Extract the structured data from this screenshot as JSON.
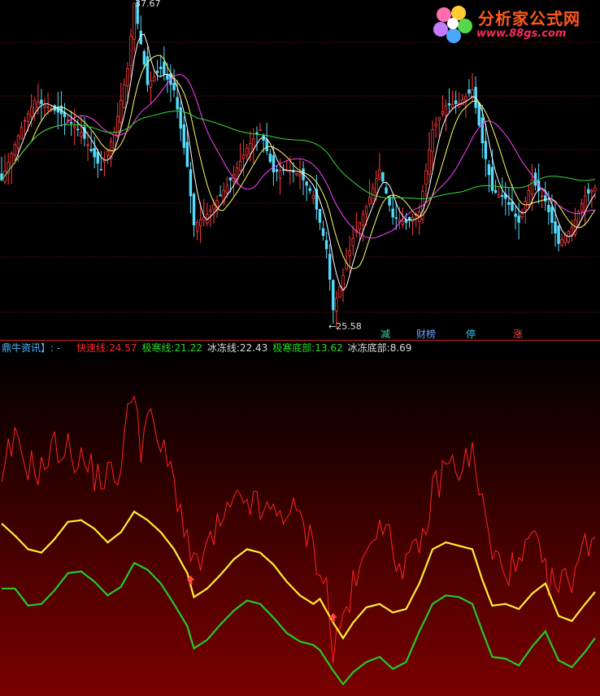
{
  "watermark": {
    "text": "分析家公式网",
    "url": "www.88gs.com"
  },
  "price_panel": {
    "high_label": "37.67",
    "low_label": "←25.58",
    "signals": [
      {
        "text": "减",
        "color": "#33dd99"
      },
      {
        "text": "财榜",
        "color": "#6aa0ff"
      },
      {
        "text": "停",
        "color": "#33ccee"
      },
      {
        "text": "涨",
        "color": "#ff4444"
      }
    ]
  },
  "indicator_panel": {
    "name": "鼎牛资讯】:",
    "items": [
      {
        "label": "快速线:",
        "value": "24.57",
        "color": "#ff2222"
      },
      {
        "label": "极寒线:",
        "value": "21.22",
        "color": "#22dd22"
      },
      {
        "label": "冰冻线:",
        "value": "22.43",
        "color": "#dddddd"
      },
      {
        "label": "极寒底部:",
        "value": "13.62",
        "color": "#22dd22"
      },
      {
        "label": "冰冻底部:",
        "value": "8.69",
        "color": "#dddddd"
      }
    ]
  },
  "chart_data": {
    "type": "line",
    "n": 180,
    "price": {
      "high": 37.67,
      "low": 25.58,
      "anchors": [
        [
          0,
          31
        ],
        [
          6,
          33
        ],
        [
          10,
          34
        ],
        [
          18,
          33.5
        ],
        [
          24,
          32.8
        ],
        [
          30,
          31.4
        ],
        [
          34,
          32.8
        ],
        [
          38,
          35.2
        ],
        [
          40,
          37.67
        ],
        [
          44,
          34.6
        ],
        [
          48,
          35.2
        ],
        [
          52,
          34.4
        ],
        [
          56,
          31.5
        ],
        [
          58,
          29.3
        ],
        [
          62,
          29.7
        ],
        [
          66,
          30.4
        ],
        [
          70,
          31.2
        ],
        [
          74,
          32.2
        ],
        [
          78,
          32.9
        ],
        [
          82,
          31.3
        ],
        [
          86,
          31.4
        ],
        [
          90,
          31.2
        ],
        [
          94,
          30.4
        ],
        [
          98,
          28.4
        ],
        [
          100,
          26.1
        ],
        [
          103,
          27.4
        ],
        [
          106,
          28.8
        ],
        [
          110,
          30.0
        ],
        [
          114,
          31.4
        ],
        [
          118,
          29.6
        ],
        [
          122,
          29.4
        ],
        [
          126,
          29.8
        ],
        [
          130,
          32.9
        ],
        [
          134,
          33.8
        ],
        [
          138,
          33.9
        ],
        [
          142,
          34.4
        ],
        [
          145,
          32.4
        ],
        [
          148,
          30.6
        ],
        [
          152,
          30.3
        ],
        [
          156,
          29.4
        ],
        [
          160,
          31.0
        ],
        [
          164,
          30.2
        ],
        [
          168,
          28.6
        ],
        [
          172,
          29.2
        ],
        [
          176,
          30.4
        ],
        [
          179,
          30.7
        ]
      ]
    },
    "indicator": {
      "fast": [
        [
          0,
          22
        ],
        [
          2,
          24.3
        ],
        [
          4,
          25
        ],
        [
          8,
          23.8
        ],
        [
          12,
          23.4
        ],
        [
          16,
          24.8
        ],
        [
          20,
          24.6
        ],
        [
          24,
          24
        ],
        [
          28,
          23.2
        ],
        [
          32,
          23.0
        ],
        [
          36,
          23.5
        ],
        [
          38,
          26.5
        ],
        [
          40,
          28.7
        ],
        [
          42,
          24.8
        ],
        [
          44,
          26.5
        ],
        [
          48,
          24.8
        ],
        [
          52,
          22.8
        ],
        [
          56,
          19.5
        ],
        [
          58,
          17.5
        ],
        [
          62,
          18.8
        ],
        [
          66,
          20.2
        ],
        [
          70,
          21.2
        ],
        [
          74,
          21.8
        ],
        [
          78,
          21.0
        ],
        [
          82,
          20.8
        ],
        [
          86,
          21.2
        ],
        [
          90,
          20.5
        ],
        [
          94,
          19.0
        ],
        [
          98,
          16.5
        ],
        [
          100,
          12.8
        ],
        [
          103,
          14.8
        ],
        [
          106,
          16.5
        ],
        [
          110,
          18.2
        ],
        [
          114,
          21.2
        ],
        [
          118,
          18.5
        ],
        [
          122,
          18.0
        ],
        [
          126,
          18.5
        ],
        [
          130,
          22.0
        ],
        [
          134,
          23.8
        ],
        [
          138,
          23.6
        ],
        [
          142,
          24.3
        ],
        [
          145,
          21.5
        ],
        [
          148,
          18.3
        ],
        [
          152,
          17.8
        ],
        [
          156,
          17.5
        ],
        [
          160,
          19.5
        ],
        [
          164,
          17.2
        ],
        [
          168,
          16.5
        ],
        [
          172,
          17.3
        ],
        [
          176,
          19.0
        ],
        [
          179,
          20.0
        ]
      ],
      "ice": [
        [
          0,
          20.3
        ],
        [
          4,
          19.6
        ],
        [
          8,
          18.8
        ],
        [
          12,
          18.6
        ],
        [
          16,
          19.4
        ],
        [
          20,
          20.4
        ],
        [
          24,
          20.5
        ],
        [
          28,
          20.0
        ],
        [
          32,
          19.2
        ],
        [
          36,
          19.8
        ],
        [
          40,
          21.0
        ],
        [
          44,
          20.5
        ],
        [
          48,
          19.8
        ],
        [
          52,
          18.8
        ],
        [
          56,
          17.4
        ],
        [
          58,
          16.0
        ],
        [
          62,
          16.5
        ],
        [
          66,
          17.3
        ],
        [
          70,
          18.2
        ],
        [
          74,
          18.8
        ],
        [
          78,
          18.6
        ],
        [
          82,
          17.9
        ],
        [
          86,
          16.9
        ],
        [
          90,
          16.1
        ],
        [
          94,
          15.6
        ],
        [
          96,
          15.9
        ],
        [
          100,
          14.5
        ],
        [
          103,
          13.6
        ],
        [
          106,
          14.5
        ],
        [
          110,
          15.4
        ],
        [
          114,
          15.6
        ],
        [
          118,
          15.1
        ],
        [
          122,
          15.3
        ],
        [
          126,
          16.8
        ],
        [
          130,
          18.8
        ],
        [
          134,
          19.2
        ],
        [
          138,
          19.0
        ],
        [
          142,
          18.8
        ],
        [
          145,
          17.0
        ],
        [
          148,
          15.5
        ],
        [
          152,
          15.6
        ],
        [
          156,
          15.3
        ],
        [
          160,
          16.2
        ],
        [
          164,
          16.8
        ],
        [
          168,
          14.9
        ],
        [
          172,
          14.6
        ],
        [
          176,
          15.6
        ],
        [
          179,
          16.3
        ]
      ],
      "cold": [
        [
          0,
          16.5
        ],
        [
          4,
          16.5
        ],
        [
          8,
          15.5
        ],
        [
          12,
          15.6
        ],
        [
          16,
          16.4
        ],
        [
          20,
          17.4
        ],
        [
          24,
          17.5
        ],
        [
          28,
          16.9
        ],
        [
          32,
          16.1
        ],
        [
          36,
          16.6
        ],
        [
          40,
          18.0
        ],
        [
          44,
          17.6
        ],
        [
          48,
          16.8
        ],
        [
          52,
          15.6
        ],
        [
          56,
          14.3
        ],
        [
          58,
          13.0
        ],
        [
          62,
          13.5
        ],
        [
          66,
          14.4
        ],
        [
          70,
          15.2
        ],
        [
          74,
          15.8
        ],
        [
          78,
          15.6
        ],
        [
          82,
          14.8
        ],
        [
          86,
          13.9
        ],
        [
          90,
          13.4
        ],
        [
          94,
          13.2
        ],
        [
          96,
          12.9
        ],
        [
          100,
          11.7
        ],
        [
          103,
          10.9
        ],
        [
          106,
          11.6
        ],
        [
          110,
          12.2
        ],
        [
          114,
          12.5
        ],
        [
          118,
          11.8
        ],
        [
          122,
          12.2
        ],
        [
          126,
          14.0
        ],
        [
          130,
          15.6
        ],
        [
          134,
          16.1
        ],
        [
          138,
          16.0
        ],
        [
          142,
          15.6
        ],
        [
          145,
          14.0
        ],
        [
          148,
          12.5
        ],
        [
          152,
          12.4
        ],
        [
          156,
          12.0
        ],
        [
          160,
          13.1
        ],
        [
          164,
          14.0
        ],
        [
          168,
          12.3
        ],
        [
          172,
          11.9
        ],
        [
          176,
          12.8
        ],
        [
          179,
          13.6
        ]
      ],
      "ymin": 10.5,
      "ymax": 30.0,
      "up_arrows": [
        57,
        100
      ]
    }
  }
}
